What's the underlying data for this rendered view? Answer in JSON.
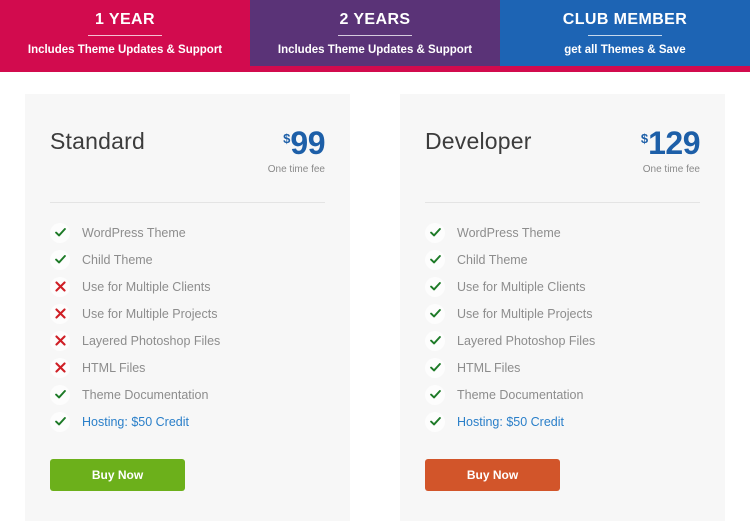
{
  "tabs": [
    {
      "title": "1 YEAR",
      "subtitle": "Includes Theme Updates & Support",
      "bg": "#d20b4e",
      "active": false
    },
    {
      "title": "2 YEARS",
      "subtitle": "Includes Theme Updates & Support",
      "bg": "#5a3377",
      "active": false
    },
    {
      "title": "CLUB MEMBER",
      "subtitle": "get all Themes & Save",
      "bg": "#1d64b4",
      "active": true
    }
  ],
  "tabbar": {
    "underbar_color": "#d20b4e"
  },
  "plans": [
    {
      "name": "Standard",
      "currency": "$",
      "amount": "99",
      "fee_note": "One time fee",
      "price_color": "#1d5fa8",
      "features": [
        {
          "label": "WordPress Theme",
          "included": true,
          "link": false
        },
        {
          "label": "Child Theme",
          "included": true,
          "link": false
        },
        {
          "label": "Use for Multiple Clients",
          "included": false,
          "link": false
        },
        {
          "label": "Use for Multiple Projects",
          "included": false,
          "link": false
        },
        {
          "label": "Layered Photoshop Files",
          "included": false,
          "link": false
        },
        {
          "label": "HTML Files",
          "included": false,
          "link": false
        },
        {
          "label": "Theme Documentation",
          "included": true,
          "link": false
        },
        {
          "label": "Hosting: $50 Credit",
          "included": true,
          "link": true
        }
      ],
      "button": {
        "label": "Buy Now",
        "color": "#6cb01b"
      }
    },
    {
      "name": "Developer",
      "currency": "$",
      "amount": "129",
      "fee_note": "One time fee",
      "price_color": "#1d5fa8",
      "features": [
        {
          "label": "WordPress Theme",
          "included": true,
          "link": false
        },
        {
          "label": "Child Theme",
          "included": true,
          "link": false
        },
        {
          "label": "Use for Multiple Clients",
          "included": true,
          "link": false
        },
        {
          "label": "Use for Multiple Projects",
          "included": true,
          "link": false
        },
        {
          "label": "Layered Photoshop Files",
          "included": true,
          "link": false
        },
        {
          "label": "HTML Files",
          "included": true,
          "link": false
        },
        {
          "label": "Theme Documentation",
          "included": true,
          "link": false
        },
        {
          "label": "Hosting: $50 Credit",
          "included": true,
          "link": true
        }
      ],
      "button": {
        "label": "Buy Now",
        "color": "#d2552a"
      }
    }
  ],
  "icons": {
    "check": "check-icon",
    "cross": "cross-icon"
  },
  "colors": {
    "check_green": "#1d7a27",
    "cross_red": "#cf1f26",
    "card_bg": "#f7f7f7",
    "divider": "#e4e4e4",
    "link_blue": "#2a7fc9",
    "feature_text": "#8d8d8d"
  }
}
